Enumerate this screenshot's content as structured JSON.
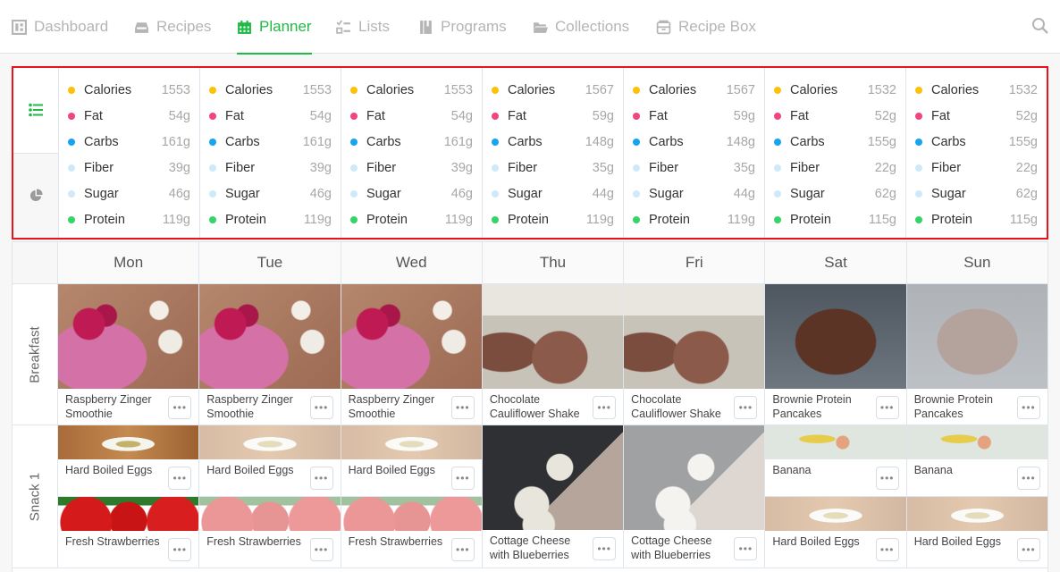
{
  "nav": {
    "items": [
      {
        "label": "Dashboard",
        "icon": "dashboard-icon",
        "active": false
      },
      {
        "label": "Recipes",
        "icon": "inbox-icon",
        "active": false
      },
      {
        "label": "Planner",
        "icon": "calendar-icon",
        "active": true
      },
      {
        "label": "Lists",
        "icon": "checklist-icon",
        "active": false
      },
      {
        "label": "Programs",
        "icon": "book-icon",
        "active": false
      },
      {
        "label": "Collections",
        "icon": "folder-icon",
        "active": false
      },
      {
        "label": "Recipe Box",
        "icon": "box-icon",
        "active": false
      }
    ],
    "search_icon": "search-icon"
  },
  "colors": {
    "accent": "#22b946",
    "calories": "#ffc107",
    "fat": "#f0457f",
    "carbs": "#16a3f0",
    "fiber": "#cfe9fb",
    "sugar": "#cfe9fb",
    "protein": "#36d26a",
    "highlight": "#e8141a"
  },
  "nutrition": {
    "toggle": [
      "list-view-icon",
      "pie-chart-icon"
    ],
    "days": [
      {
        "Calories": "1553",
        "Fat": "54g",
        "Carbs": "161g",
        "Fiber": "39g",
        "Sugar": "46g",
        "Protein": "119g"
      },
      {
        "Calories": "1553",
        "Fat": "54g",
        "Carbs": "161g",
        "Fiber": "39g",
        "Sugar": "46g",
        "Protein": "119g"
      },
      {
        "Calories": "1553",
        "Fat": "54g",
        "Carbs": "161g",
        "Fiber": "39g",
        "Sugar": "46g",
        "Protein": "119g"
      },
      {
        "Calories": "1567",
        "Fat": "59g",
        "Carbs": "148g",
        "Fiber": "35g",
        "Sugar": "44g",
        "Protein": "119g"
      },
      {
        "Calories": "1567",
        "Fat": "59g",
        "Carbs": "148g",
        "Fiber": "35g",
        "Sugar": "44g",
        "Protein": "119g"
      },
      {
        "Calories": "1532",
        "Fat": "52g",
        "Carbs": "155g",
        "Fiber": "22g",
        "Sugar": "62g",
        "Protein": "115g"
      },
      {
        "Calories": "1532",
        "Fat": "52g",
        "Carbs": "155g",
        "Fiber": "22g",
        "Sugar": "62g",
        "Protein": "115g"
      }
    ],
    "labels": [
      "Calories",
      "Fat",
      "Carbs",
      "Fiber",
      "Sugar",
      "Protein"
    ]
  },
  "planner": {
    "days": [
      "Mon",
      "Tue",
      "Wed",
      "Thu",
      "Fri",
      "Sat",
      "Sun"
    ],
    "meals": [
      {
        "name": "Breakfast",
        "cells": [
          [
            {
              "title": "Raspberry Zinger Smoothie",
              "img": "rasp",
              "faded": false
            }
          ],
          [
            {
              "title": "Raspberry Zinger Smoothie",
              "img": "rasp",
              "faded": false
            }
          ],
          [
            {
              "title": "Raspberry Zinger Smoothie",
              "img": "rasp",
              "faded": false
            }
          ],
          [
            {
              "title": "Chocolate Cauliflower Shake",
              "img": "choc",
              "faded": false
            }
          ],
          [
            {
              "title": "Chocolate Cauliflower Shake",
              "img": "choc",
              "faded": false
            }
          ],
          [
            {
              "title": "Brownie Protein Pancakes",
              "img": "pancake",
              "faded": false
            }
          ],
          [
            {
              "title": "Brownie Protein Pancakes",
              "img": "pancake",
              "faded": true
            }
          ]
        ]
      },
      {
        "name": "Snack 1",
        "cells": [
          [
            {
              "title": "Hard Boiled Eggs",
              "img": "egg",
              "faded": false
            },
            {
              "title": "Fresh Strawberries",
              "img": "straw",
              "faded": false
            }
          ],
          [
            {
              "title": "Hard Boiled Eggs",
              "img": "egg",
              "faded": true
            },
            {
              "title": "Fresh Strawberries",
              "img": "straw",
              "faded": true
            }
          ],
          [
            {
              "title": "Hard Boiled Eggs",
              "img": "egg",
              "faded": true
            },
            {
              "title": "Fresh Strawberries",
              "img": "straw",
              "faded": true
            }
          ],
          [
            {
              "title": "Cottage Cheese with Blueberries",
              "img": "cottage",
              "faded": false
            }
          ],
          [
            {
              "title": "Cottage Cheese with Blueberries",
              "img": "cottage",
              "faded": true
            }
          ],
          [
            {
              "title": "Banana",
              "img": "banana",
              "faded": false
            },
            {
              "title": "Hard Boiled Eggs",
              "img": "egg",
              "faded": true
            }
          ],
          [
            {
              "title": "Banana",
              "img": "banana",
              "faded": false
            },
            {
              "title": "Hard Boiled Eggs",
              "img": "egg",
              "faded": true
            }
          ]
        ]
      }
    ],
    "more_label": "•••"
  }
}
